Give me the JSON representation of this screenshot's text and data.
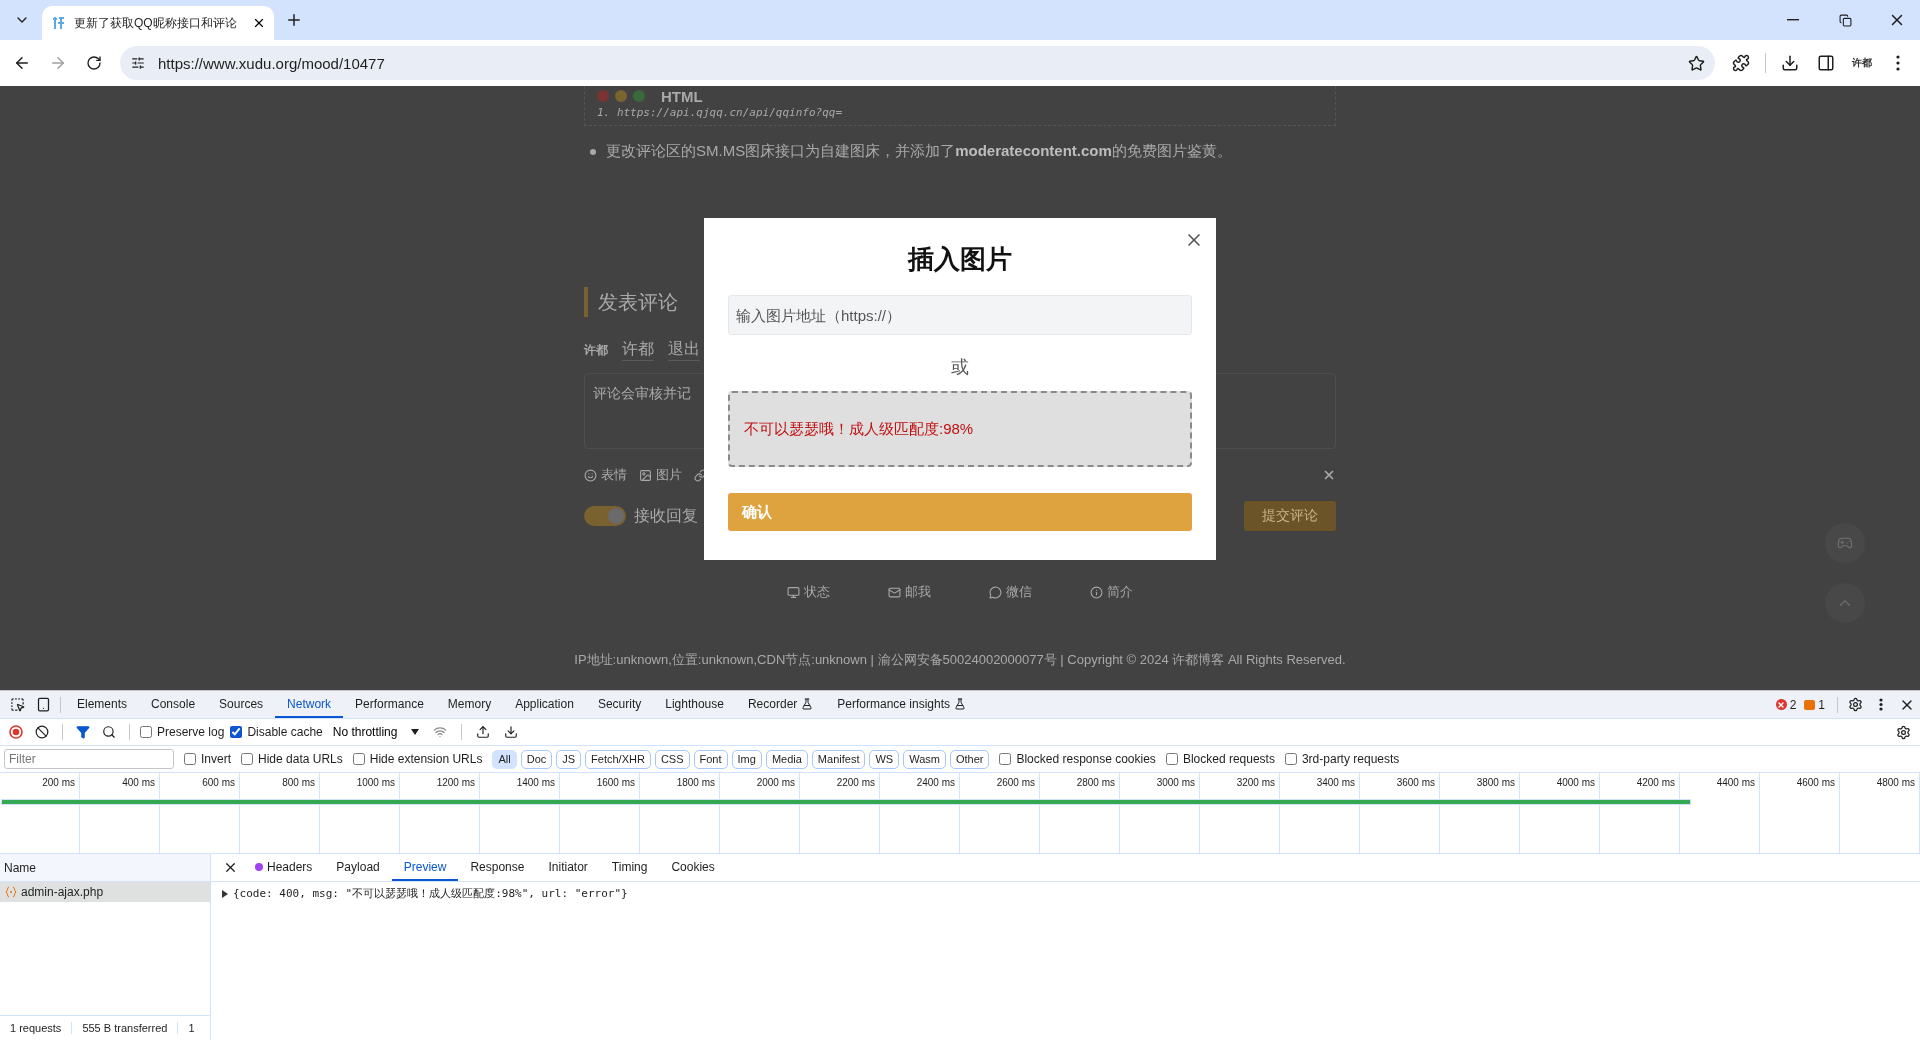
{
  "browser": {
    "tab": {
      "title": "更新了获取QQ昵称接口和评论"
    },
    "url": "https://www.xudu.org/mood/10477",
    "profile": "许都"
  },
  "page": {
    "code_block": {
      "language": "HTML",
      "line_number": "1.",
      "code": "https://api.qjqq.cn/api/qqinfo?qq="
    },
    "bullet": "更改评论区的SM.MS图床接口为自建图床，并添加了**moderatecontent.com**的免费图片鉴黄。",
    "comment_form": {
      "heading": "发表评论",
      "user_logo": "许都",
      "user_name": "许都",
      "logout": "退出",
      "placeholder": "评论会审核并记",
      "tools": [
        {
          "kind": "emoji",
          "label": "表情"
        },
        {
          "kind": "image",
          "label": "图片"
        }
      ],
      "reply_toggle": {
        "label": "接收回复",
        "on": true
      },
      "submit": "提交评论"
    },
    "footer_links": [
      {
        "kind": "monitor",
        "label": "状态"
      },
      {
        "kind": "mail",
        "label": "邮我"
      },
      {
        "kind": "chat",
        "label": "微信"
      },
      {
        "kind": "info",
        "label": "简介"
      }
    ],
    "footer_text": "IP地址:unknown,位置:unknown,CDN节点:unknown | 渝公网安备50024002000077号 | Copyright © 2024 许都博客 All Rights Reserved."
  },
  "modal": {
    "title": "插入图片",
    "url_field": {
      "placeholder": "输入图片地址（https://）"
    },
    "separator": "或",
    "drop_zone": {
      "message": "不可以瑟瑟哦！成人级匹配度:98%"
    },
    "confirm": "确认"
  },
  "devtools": {
    "tabs": [
      {
        "label": "Elements",
        "selected": false,
        "experimental": false
      },
      {
        "label": "Console",
        "selected": false,
        "experimental": false
      },
      {
        "label": "Sources",
        "selected": false,
        "experimental": false
      },
      {
        "label": "Network",
        "selected": true,
        "experimental": false
      },
      {
        "label": "Performance",
        "selected": false,
        "experimental": false
      },
      {
        "label": "Memory",
        "selected": false,
        "experimental": false
      },
      {
        "label": "Application",
        "selected": false,
        "experimental": false
      },
      {
        "label": "Security",
        "selected": false,
        "experimental": false
      },
      {
        "label": "Lighthouse",
        "selected": false,
        "experimental": false
      },
      {
        "label": "Recorder",
        "selected": false,
        "experimental": true
      },
      {
        "label": "Performance insights",
        "selected": false,
        "experimental": true
      }
    ],
    "error_count": "2",
    "warning_count": "1",
    "toolbar": {
      "preserve_log": {
        "label": "Preserve log",
        "checked": false
      },
      "disable_cache": {
        "label": "Disable cache",
        "checked": true
      },
      "throttling": "No throttling"
    },
    "filter": {
      "placeholder": "Filter",
      "options": [
        {
          "label": "Invert",
          "checked": false
        },
        {
          "label": "Hide data URLs",
          "checked": false
        },
        {
          "label": "Hide extension URLs",
          "checked": false
        }
      ],
      "types": [
        {
          "label": "All",
          "selected": true
        },
        {
          "label": "Doc",
          "selected": false
        },
        {
          "label": "JS",
          "selected": false
        },
        {
          "label": "Fetch/XHR",
          "selected": false
        },
        {
          "label": "CSS",
          "selected": false
        },
        {
          "label": "Font",
          "selected": false
        },
        {
          "label": "Img",
          "selected": false
        },
        {
          "label": "Media",
          "selected": false
        },
        {
          "label": "Manifest",
          "selected": false
        },
        {
          "label": "WS",
          "selected": false
        },
        {
          "label": "Wasm",
          "selected": false
        },
        {
          "label": "Other",
          "selected": false
        }
      ],
      "blocked": [
        {
          "label": "Blocked response cookies",
          "checked": false
        },
        {
          "label": "Blocked requests",
          "checked": false
        },
        {
          "label": "3rd-party requests",
          "checked": false
        }
      ]
    },
    "timeline_ticks": [
      "200 ms",
      "400 ms",
      "600 ms",
      "800 ms",
      "1000 ms",
      "1200 ms",
      "1400 ms",
      "1600 ms",
      "1800 ms",
      "2000 ms",
      "2200 ms",
      "2400 ms",
      "2600 ms",
      "2800 ms",
      "3000 ms",
      "3200 ms",
      "3400 ms",
      "3600 ms",
      "3800 ms",
      "4000 ms",
      "4200 ms",
      "4400 ms",
      "4600 ms",
      "4800 ms"
    ],
    "name_column": "Name",
    "requests": [
      {
        "name": "admin-ajax.php",
        "selected": true
      }
    ],
    "detail_tabs": [
      {
        "label": "Headers",
        "selected": false,
        "dot": true
      },
      {
        "label": "Payload",
        "selected": false,
        "dot": false
      },
      {
        "label": "Preview",
        "selected": true,
        "dot": false
      },
      {
        "label": "Response",
        "selected": false,
        "dot": false
      },
      {
        "label": "Initiator",
        "selected": false,
        "dot": false
      },
      {
        "label": "Timing",
        "selected": false,
        "dot": false
      },
      {
        "label": "Cookies",
        "selected": false,
        "dot": false
      }
    ],
    "preview": "{code: 400, msg: \"不可以瑟瑟哦！成人级匹配度:98%\", url: \"error\"}",
    "status": [
      "1 requests",
      "555 B transferred",
      "1"
    ]
  }
}
